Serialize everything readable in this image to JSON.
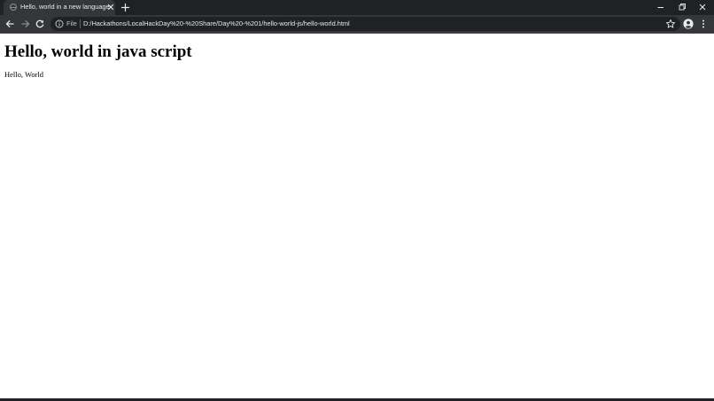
{
  "browser": {
    "tab": {
      "title": "Hello, world in a new language",
      "favicon": "globe-icon"
    },
    "address_bar": {
      "scheme_label": "File",
      "url": "D:/Hackathons/LocalHackDay%20-%20Share/Day%20-%201/hello-world-js/hello-world.html"
    },
    "icons": {
      "back": "arrow-left-icon",
      "forward": "arrow-right-icon",
      "reload": "reload-icon",
      "info": "info-icon",
      "bookmark": "star-icon",
      "profile": "account-icon",
      "menu": "kebab-menu-icon",
      "new_tab": "plus-icon",
      "tab_close": "close-icon",
      "minimize": "minimize-icon",
      "restore": "restore-icon",
      "close": "close-icon"
    },
    "colors": {
      "frame": "#202124",
      "toolbar": "#35363a",
      "text": "#e8eaed",
      "page_background": "#ffffff"
    }
  },
  "page": {
    "heading": "Hello, world in java script",
    "body_text": "Hello, World"
  }
}
